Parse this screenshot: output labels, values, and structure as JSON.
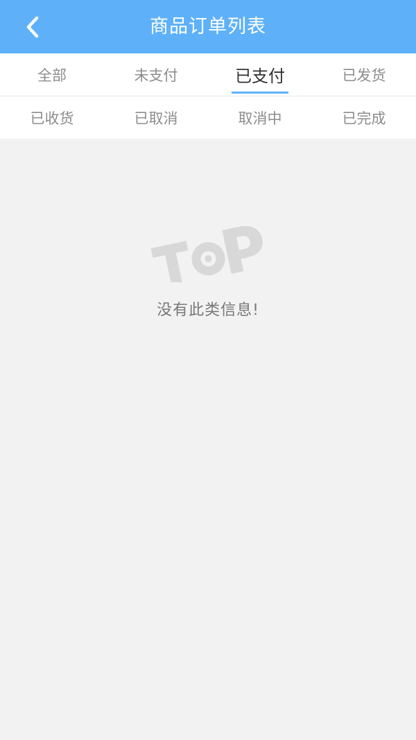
{
  "header": {
    "title": "商品订单列表",
    "back_icon": "chevron-left-icon"
  },
  "tabs": {
    "row1": [
      {
        "label": "全部",
        "active": false
      },
      {
        "label": "未支付",
        "active": false
      },
      {
        "label": "已支付",
        "active": true
      },
      {
        "label": "已发货",
        "active": false
      }
    ],
    "row2": [
      {
        "label": "已收货",
        "active": false
      },
      {
        "label": "已取消",
        "active": false
      },
      {
        "label": "取消中",
        "active": false
      },
      {
        "label": "已完成",
        "active": false
      }
    ]
  },
  "empty_state": {
    "logo_icon": "top-logo-icon",
    "logo_text": "TOP",
    "message": "没有此类信息!"
  },
  "colors": {
    "accent": "#5eb1f8",
    "background": "#f2f2f2",
    "logo": "#d8d8d8"
  }
}
